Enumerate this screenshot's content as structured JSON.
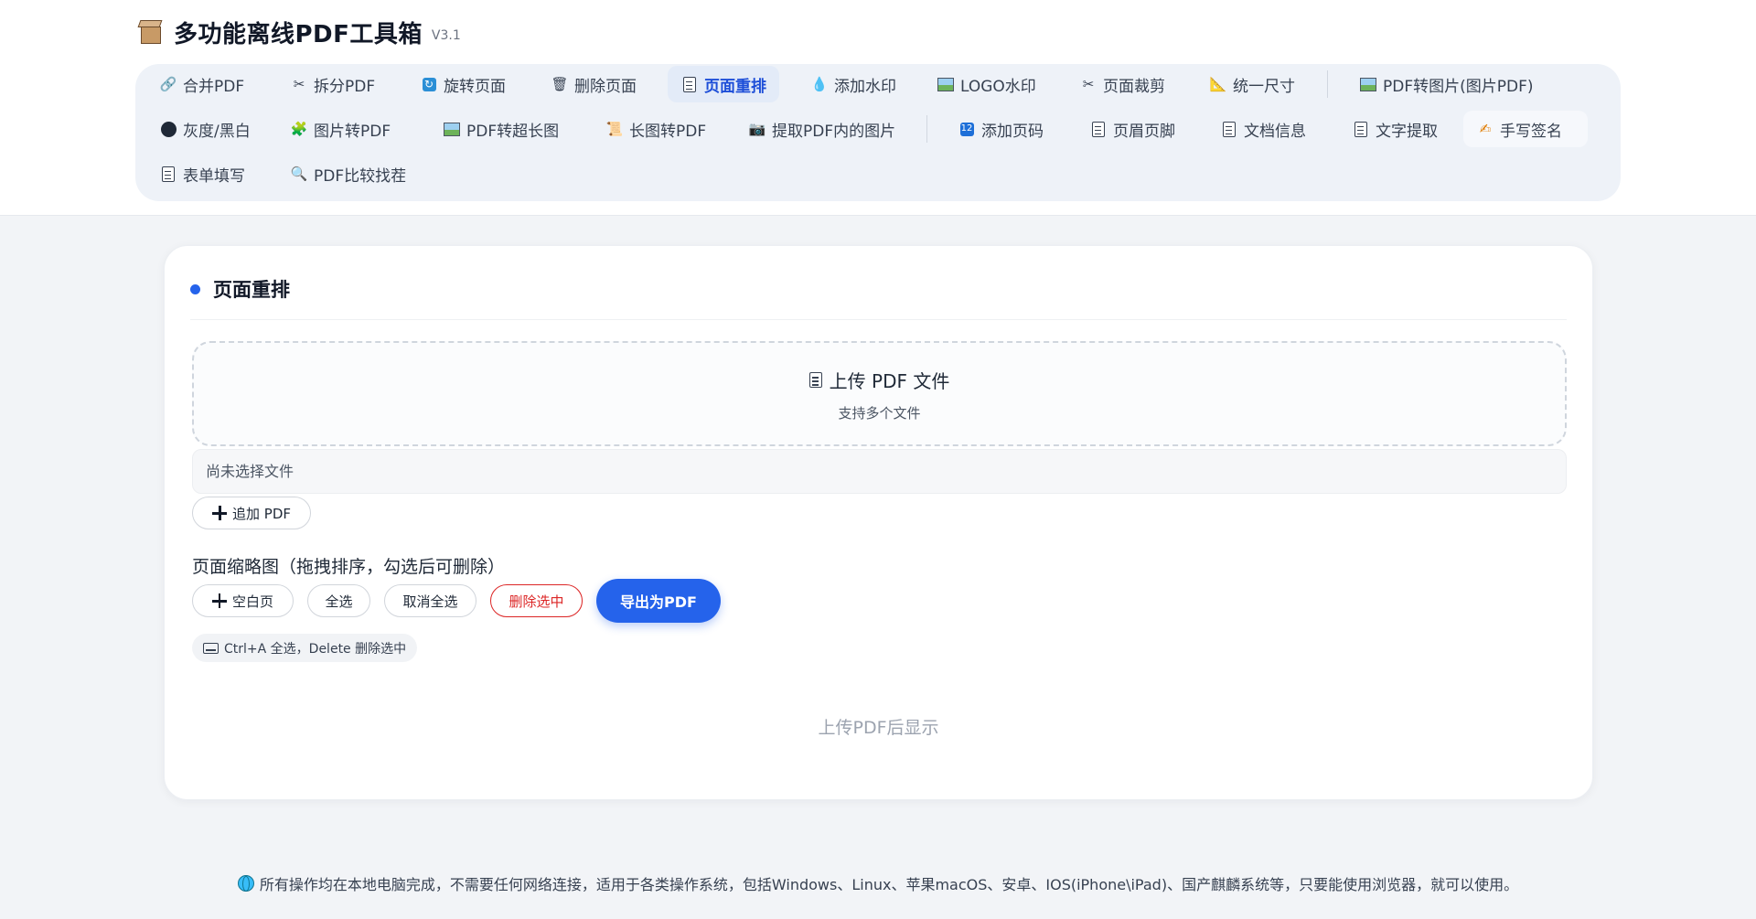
{
  "app": {
    "title": "多功能离线PDF工具箱",
    "version": "V3.1"
  },
  "toolbar": {
    "row1": [
      {
        "label": "合并PDF",
        "icon": "link-icon"
      },
      {
        "label": "拆分PDF",
        "icon": "scissors-icon"
      },
      {
        "label": "旋转页面",
        "icon": "rotate-icon"
      },
      {
        "label": "删除页面",
        "icon": "trash-icon"
      },
      {
        "label": "页面重排",
        "icon": "document-icon"
      },
      {
        "label": "添加水印",
        "icon": "droplet-icon"
      },
      {
        "label": "LOGO水印",
        "icon": "picture-icon"
      },
      {
        "label": "页面裁剪",
        "icon": "scissors-icon"
      },
      {
        "label": "统一尺寸",
        "icon": "ruler-icon"
      },
      {
        "label": "PDF转图片(图片PDF)",
        "icon": "picture-icon"
      }
    ],
    "row2": [
      {
        "label": "灰度/黑白",
        "icon": "black-circle-icon"
      },
      {
        "label": "图片转PDF",
        "icon": "puzzle-icon"
      },
      {
        "label": "PDF转超长图",
        "icon": "picture-icon"
      },
      {
        "label": "长图转PDF",
        "icon": "scroll-icon"
      },
      {
        "label": "提取PDF内的图片",
        "icon": "camera-icon"
      },
      {
        "label": "添加页码",
        "icon": "numbers-icon"
      },
      {
        "label": "页眉页脚",
        "icon": "memo-icon"
      },
      {
        "label": "文档信息",
        "icon": "memo-icon"
      },
      {
        "label": "文字提取",
        "icon": "page-icon"
      },
      {
        "label": "手写签名",
        "icon": "pen-icon"
      }
    ],
    "row3": [
      {
        "label": "表单填写",
        "icon": "memo-icon"
      },
      {
        "label": "PDF比较找茬",
        "icon": "magnifier-icon"
      }
    ],
    "active": "页面重排",
    "accent": "#2563eb"
  },
  "main": {
    "title": "页面重排",
    "upload": {
      "title": "上传 PDF 文件",
      "subtitle": "支持多个文件"
    },
    "file_status": "尚未选择文件",
    "add_pdf_label": "追加 PDF",
    "thumbnail_label": "页面缩略图（拖拽排序，勾选后可删除）",
    "buttons": {
      "blank_page": "空白页",
      "select_all": "全选",
      "deselect_all": "取消全选",
      "delete_selected": "删除选中",
      "export": "导出为PDF"
    },
    "shortcut_hint": "Ctrl+A 全选，Delete 删除选中",
    "empty_hint": "上传PDF后显示"
  },
  "footer": {
    "text": "所有操作均在本地电脑完成，不需要任何网络连接，适用于各类操作系统，包括Windows、Linux、苹果macOS、安卓、IOS(iPhone\\iPad)、国产麒麟系统等，只要能使用浏览器，就可以使用。"
  }
}
